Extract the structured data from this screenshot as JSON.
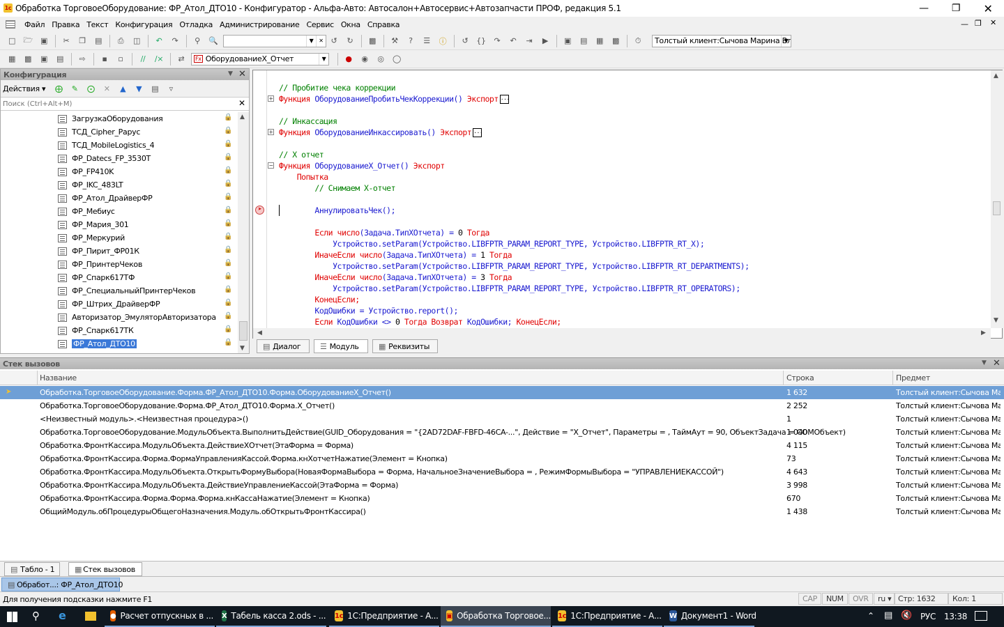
{
  "window": {
    "title": "Обработка ТорговоеОборудование: ФР_Атол_ДТО10 - Конфигуратор - Альфа-Авто: Автосалон+Автосервис+Автозапчасти ПРОФ, редакция 5.1"
  },
  "menu": [
    "Файл",
    "Правка",
    "Текст",
    "Конфигурация",
    "Отладка",
    "Администрирование",
    "Сервис",
    "Окна",
    "Справка"
  ],
  "toolbar": {
    "client_combo": "Толстый клиент:Сычова Марина Вл",
    "procedure_combo": "ОборудованиеX_Отчет"
  },
  "config_panel": {
    "title": "Конфигурация",
    "actions_label": "Действия",
    "search_placeholder": "Поиск (Ctrl+Alt+M)",
    "items": [
      "ЗагрузкаОборудования",
      "ТСД_Cipher_Рарус",
      "ТСД_MobileLogistics_4",
      "ФР_Datecs_FP_3530T",
      "ФР_FP410K",
      "ФР_IKC_483LT",
      "ФР_Атол_ДрайверФР",
      "ФР_Мебиус",
      "ФР_Мария_301",
      "ФР_Меркурий",
      "ФР_Пирит_ФР01К",
      "ФР_ПринтерЧеков",
      "ФР_Спарк617ТФ",
      "ФР_СпециальныйПринтерЧеков",
      "ФР_Штрих_ДрайверФР",
      "Авторизатор_ЭмуляторАвторизатора",
      "ФР_Спарк617ТК",
      "ФР_Атол_ДТО10"
    ]
  },
  "editor": {
    "lines": [
      {
        "indent": "",
        "parts": [
          {
            "t": "// Пробитие чека коррекции",
            "c": "cm"
          }
        ]
      },
      {
        "indent": "",
        "fold": "+",
        "parts": [
          {
            "t": "Функция ",
            "c": "kw"
          },
          {
            "t": "ОборудованиеПробитьЧекКоррекции",
            "c": "id"
          },
          {
            "t": "() ",
            "c": "id"
          },
          {
            "t": "Экспорт",
            "c": "kw"
          }
        ],
        "box": true
      },
      {
        "indent": "",
        "parts": []
      },
      {
        "indent": "",
        "parts": [
          {
            "t": "// Инкассация",
            "c": "cm"
          }
        ]
      },
      {
        "indent": "",
        "fold": "+",
        "parts": [
          {
            "t": "Функция ",
            "c": "kw"
          },
          {
            "t": "ОборудованиеИнкассировать",
            "c": "id"
          },
          {
            "t": "() ",
            "c": "id"
          },
          {
            "t": "Экспорт",
            "c": "kw"
          }
        ],
        "box": true
      },
      {
        "indent": "",
        "parts": []
      },
      {
        "indent": "",
        "parts": [
          {
            "t": "// X отчет",
            "c": "cm"
          }
        ]
      },
      {
        "indent": "",
        "fold": "-",
        "parts": [
          {
            "t": "Функция ",
            "c": "kw"
          },
          {
            "t": "ОборудованиеX_Отчет",
            "c": "id"
          },
          {
            "t": "() ",
            "c": "id"
          },
          {
            "t": "Экспорт",
            "c": "kw"
          }
        ]
      },
      {
        "indent": "    ",
        "parts": [
          {
            "t": "Попытка",
            "c": "kw"
          }
        ]
      },
      {
        "indent": "        ",
        "parts": [
          {
            "t": "// Снимаем X-отчет",
            "c": "cm"
          }
        ]
      },
      {
        "indent": "",
        "parts": []
      },
      {
        "indent": "        ",
        "bp": true,
        "parts": [
          {
            "t": "АннулироватьЧек",
            "c": "id"
          },
          {
            "t": "();",
            "c": "id"
          }
        ]
      },
      {
        "indent": "",
        "parts": []
      },
      {
        "indent": "        ",
        "parts": [
          {
            "t": "Если ",
            "c": "kw"
          },
          {
            "t": "число",
            "c": "kw"
          },
          {
            "t": "(Задача.ТипXОтчета) = ",
            "c": "id"
          },
          {
            "t": "0 ",
            "c": "nm"
          },
          {
            "t": "Тогда",
            "c": "kw"
          }
        ]
      },
      {
        "indent": "            ",
        "parts": [
          {
            "t": "Устройство.setParam(Устройство.LIBFPTR_PARAM_REPORT_TYPE, Устройство.LIBFPTR_RT_X);",
            "c": "id"
          }
        ]
      },
      {
        "indent": "        ",
        "parts": [
          {
            "t": "ИначеЕсли ",
            "c": "kw"
          },
          {
            "t": "число",
            "c": "kw"
          },
          {
            "t": "(Задача.ТипXОтчета) = ",
            "c": "id"
          },
          {
            "t": "1 ",
            "c": "nm"
          },
          {
            "t": "Тогда",
            "c": "kw"
          }
        ]
      },
      {
        "indent": "            ",
        "parts": [
          {
            "t": "Устройство.setParam(Устройство.LIBFPTR_PARAM_REPORT_TYPE, Устройство.LIBFPTR_RT_DEPARTMENTS);",
            "c": "id"
          }
        ]
      },
      {
        "indent": "        ",
        "parts": [
          {
            "t": "ИначеЕсли ",
            "c": "kw"
          },
          {
            "t": "число",
            "c": "kw"
          },
          {
            "t": "(Задача.ТипXОтчета) = ",
            "c": "id"
          },
          {
            "t": "3 ",
            "c": "nm"
          },
          {
            "t": "Тогда",
            "c": "kw"
          }
        ]
      },
      {
        "indent": "            ",
        "parts": [
          {
            "t": "Устройство.setParam(Устройство.LIBFPTR_PARAM_REPORT_TYPE, Устройство.LIBFPTR_RT_OPERATORS);",
            "c": "id"
          }
        ]
      },
      {
        "indent": "        ",
        "parts": [
          {
            "t": "КонецЕсли;",
            "c": "kw"
          }
        ]
      },
      {
        "indent": "        ",
        "parts": [
          {
            "t": "КодОшибки = Устройство.report();",
            "c": "id"
          }
        ]
      },
      {
        "indent": "        ",
        "parts": [
          {
            "t": "Если ",
            "c": "kw"
          },
          {
            "t": "КодОшибки <> ",
            "c": "id"
          },
          {
            "t": "0 ",
            "c": "nm"
          },
          {
            "t": "Тогда Возврат ",
            "c": "kw"
          },
          {
            "t": "КодОшибки; ",
            "c": "id"
          },
          {
            "t": "КонецЕсли;",
            "c": "kw"
          }
        ]
      }
    ],
    "tabs": [
      "Диалог",
      "Модуль",
      "Реквизиты"
    ]
  },
  "callstack": {
    "title": "Стек вызовов",
    "columns": [
      "Название",
      "Строка",
      "Предмет"
    ],
    "rows": [
      {
        "name": "Обработка.ТорговоеОборудование.Форма.ФР_Атол_ДТО10.Форма.ОборудованиеX_Отчет()",
        "line": "1 632",
        "subject": "Толстый клиент:Сычова Ма..."
      },
      {
        "name": "Обработка.ТорговоеОборудование.Форма.ФР_Атол_ДТО10.Форма.X_Отчет()",
        "line": "2 252",
        "subject": "Толстый клиент:Сычова Ма..."
      },
      {
        "name": "<Неизвестный модуль>.<Неизвестная процедура>()",
        "line": "1",
        "subject": "Толстый клиент:Сычова Ма..."
      },
      {
        "name": "Обработка.ТорговоеОборудование.МодульОбъекта.ВыполнитьДействие(GUID_Оборудования = \"{2AD72DAF-FBFD-46CA-...\", Действие = \"X_Отчет\", Параметры = , ТаймАут = 90, ОбъектЗадача = COMОбъект)",
        "line": "1 040",
        "subject": "Толстый клиент:Сычова Ма..."
      },
      {
        "name": "Обработка.ФронтКассира.МодульОбъекта.ДействиеXОтчет(ЭтаФорма = Форма)",
        "line": "4 115",
        "subject": "Толстый клиент:Сычова Ма..."
      },
      {
        "name": "Обработка.ФронтКассира.Форма.ФормаУправленияКассой.Форма.кнXотчетНажатие(Элемент = Кнопка)",
        "line": "73",
        "subject": "Толстый клиент:Сычова Ма..."
      },
      {
        "name": "Обработка.ФронтКассира.МодульОбъекта.ОткрытьФормуВыбора(НоваяФормаВыбора = Форма, НачальноеЗначениеВыбора = , РежимФормыВыбора = \"УПРАВЛЕНИЕКАССОЙ\")",
        "line": "4 643",
        "subject": "Толстый клиент:Сычова Ма..."
      },
      {
        "name": "Обработка.ФронтКассира.МодульОбъекта.ДействиеУправлениеКассой(ЭтаФорма = Форма)",
        "line": "3 998",
        "subject": "Толстый клиент:Сычова Ма..."
      },
      {
        "name": "Обработка.ФронтКассира.Форма.Форма.Форма.кнКассаНажатие(Элемент = Кнопка)",
        "line": "670",
        "subject": "Толстый клиент:Сычова Ма..."
      },
      {
        "name": "ОбщийМодуль.обПроцедурыОбщегоНазначения.Модуль.обОткрытьФронтКассира()",
        "line": "1 438",
        "subject": "Толстый клиент:Сычова Ма..."
      }
    ]
  },
  "bottom_tabs": [
    "Табло - 1",
    "Стек вызовов"
  ],
  "window_tab": "Обработ...: ФР_Атол_ДТО10",
  "status": {
    "hint": "Для получения подсказки нажмите F1",
    "cap": "CAP",
    "num": "NUM",
    "ovr": "OVR",
    "lang": "ru",
    "row": "Стр: 1632",
    "col": "Кол: 1"
  },
  "taskbar": {
    "tasks": [
      "Расчет отпускных в ...",
      "Табель касса 2.ods - ...",
      "1С:Предприятие - А...",
      "Обработка Торговое...",
      "1С:Предприятие - А...",
      "Документ1 - Word"
    ],
    "lang": "РУС",
    "time": "13:38"
  },
  "colors": {
    "selection": "#6e9fd6",
    "keyword": "#e00000",
    "identifier": "#1a1ad0",
    "comment": "#008000",
    "taskbar": "#101820"
  }
}
